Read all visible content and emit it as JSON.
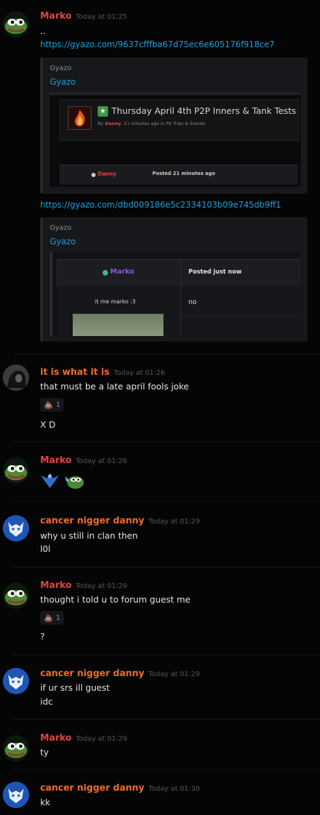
{
  "messages": [
    {
      "author": "Marko",
      "time": "Today at 01:25",
      "lines": [
        ".."
      ]
    },
    {
      "author": "it is what it is",
      "time": "Today at 01:26",
      "lines": [
        "that must be a late april fools joke",
        "X D"
      ]
    },
    {
      "author": "Marko",
      "time": "Today at 01:26"
    },
    {
      "author": "cancer nigger danny",
      "time": "Today at 01:29",
      "lines": [
        "why u still in clan then",
        "l0l"
      ]
    },
    {
      "author": "Marko",
      "time": "Today at 01:29",
      "lines": [
        "thought i told u to forum guest me",
        "?"
      ]
    },
    {
      "author": "cancer nigger danny",
      "time": "Today at 01:29",
      "lines": [
        "if ur srs ill guest",
        "idc"
      ]
    },
    {
      "author": "Marko",
      "time": "Today at 01:29",
      "lines": [
        "ty"
      ]
    },
    {
      "author": "cancer nigger danny",
      "time": "Today at 01:30",
      "lines": [
        "kk"
      ]
    }
  ],
  "links": [
    "https://gyazo.com/9637cfffba67d75ec6e605176f918ce7",
    "https://gyazo.com/dbd009186e5c2334103b09e745db9ff1"
  ],
  "embeds": [
    {
      "provider": "Gyazo",
      "title": "Gyazo",
      "thread_title": "Thursday April 4th P2P Inners & Tank Tests",
      "thread_by": "By",
      "thread_author": "Danny",
      "thread_meta": ", 21 minutes ago in PK Trips & Events",
      "post_author": "Danny",
      "post_time": "Posted 21 minutes ago"
    },
    {
      "provider": "Gyazo",
      "title": "Gyazo",
      "post_author": "Marko",
      "post_time": "Posted just now",
      "signature": "it me marko :3",
      "post_body": "no"
    }
  ],
  "reactions": [
    {
      "emoji": "💩",
      "count": "1"
    },
    {
      "emoji": "💩",
      "count": "1"
    }
  ],
  "colors": {
    "marko": "#e0463f",
    "orange_user": "#f26b2a",
    "link": "#1e9fdc",
    "online": "#43b581"
  }
}
